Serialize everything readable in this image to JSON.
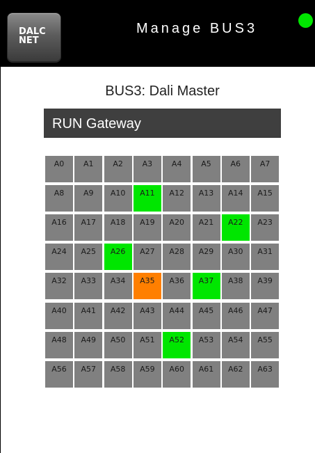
{
  "header": {
    "logo_text": "DALC\nNET",
    "title": "Manage BUS3",
    "status_color": "#00e600"
  },
  "main": {
    "bus_label": "BUS3: Dali Master",
    "run_button_label": "RUN Gateway"
  },
  "colors": {
    "default_cell": "#808080",
    "active_cell": "#00e600",
    "selected_cell": "#ff7f00"
  },
  "grid": {
    "columns": 8,
    "cells": [
      {
        "label": "A0",
        "state": "default"
      },
      {
        "label": "A1",
        "state": "default"
      },
      {
        "label": "A2",
        "state": "default"
      },
      {
        "label": "A3",
        "state": "default"
      },
      {
        "label": "A4",
        "state": "default"
      },
      {
        "label": "A5",
        "state": "default"
      },
      {
        "label": "A6",
        "state": "default"
      },
      {
        "label": "A7",
        "state": "default"
      },
      {
        "label": "A8",
        "state": "default"
      },
      {
        "label": "A9",
        "state": "default"
      },
      {
        "label": "A10",
        "state": "default"
      },
      {
        "label": "A11",
        "state": "active"
      },
      {
        "label": "A12",
        "state": "default"
      },
      {
        "label": "A13",
        "state": "default"
      },
      {
        "label": "A14",
        "state": "default"
      },
      {
        "label": "A15",
        "state": "default"
      },
      {
        "label": "A16",
        "state": "default"
      },
      {
        "label": "A17",
        "state": "default"
      },
      {
        "label": "A18",
        "state": "default"
      },
      {
        "label": "A19",
        "state": "default"
      },
      {
        "label": "A20",
        "state": "default"
      },
      {
        "label": "A21",
        "state": "default"
      },
      {
        "label": "A22",
        "state": "active"
      },
      {
        "label": "A23",
        "state": "default"
      },
      {
        "label": "A24",
        "state": "default"
      },
      {
        "label": "A25",
        "state": "default"
      },
      {
        "label": "A26",
        "state": "active"
      },
      {
        "label": "A27",
        "state": "default"
      },
      {
        "label": "A28",
        "state": "default"
      },
      {
        "label": "A29",
        "state": "default"
      },
      {
        "label": "A30",
        "state": "default"
      },
      {
        "label": "A31",
        "state": "default"
      },
      {
        "label": "A32",
        "state": "default"
      },
      {
        "label": "A33",
        "state": "default"
      },
      {
        "label": "A34",
        "state": "default"
      },
      {
        "label": "A35",
        "state": "selected"
      },
      {
        "label": "A36",
        "state": "default"
      },
      {
        "label": "A37",
        "state": "active"
      },
      {
        "label": "A38",
        "state": "default"
      },
      {
        "label": "A39",
        "state": "default"
      },
      {
        "label": "A40",
        "state": "default"
      },
      {
        "label": "A41",
        "state": "default"
      },
      {
        "label": "A42",
        "state": "default"
      },
      {
        "label": "A43",
        "state": "default"
      },
      {
        "label": "A44",
        "state": "default"
      },
      {
        "label": "A45",
        "state": "default"
      },
      {
        "label": "A46",
        "state": "default"
      },
      {
        "label": "A47",
        "state": "default"
      },
      {
        "label": "A48",
        "state": "default"
      },
      {
        "label": "A49",
        "state": "default"
      },
      {
        "label": "A50",
        "state": "default"
      },
      {
        "label": "A51",
        "state": "default"
      },
      {
        "label": "A52",
        "state": "active"
      },
      {
        "label": "A53",
        "state": "default"
      },
      {
        "label": "A54",
        "state": "default"
      },
      {
        "label": "A55",
        "state": "default"
      },
      {
        "label": "A56",
        "state": "default"
      },
      {
        "label": "A57",
        "state": "default"
      },
      {
        "label": "A58",
        "state": "default"
      },
      {
        "label": "A59",
        "state": "default"
      },
      {
        "label": "A60",
        "state": "default"
      },
      {
        "label": "A61",
        "state": "default"
      },
      {
        "label": "A62",
        "state": "default"
      },
      {
        "label": "A63",
        "state": "default"
      }
    ]
  }
}
